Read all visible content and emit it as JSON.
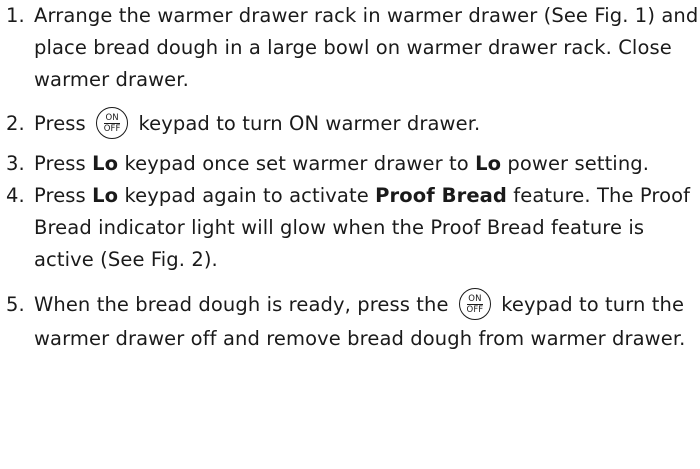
{
  "steps": [
    {
      "num": "1.",
      "text": "Arrange the warmer drawer rack in warmer drawer (See Fig. 1) and place bread dough in a large bowl on warmer drawer rack. Close warmer drawer."
    },
    {
      "num": "2.",
      "pre": "Press",
      "post": "keypad to turn ON warmer drawer."
    },
    {
      "num": "3.",
      "p1": "Press ",
      "b1": "Lo",
      "p2": " keypad once set warmer drawer to ",
      "b2": "Lo",
      "p3": " power setting."
    },
    {
      "num": "4.",
      "p1": "Press ",
      "b1": "Lo",
      "p2": " keypad again to activate ",
      "b2": "Proof Bread",
      "p3": " feature. The Proof Bread indicator light will glow when the Proof Bread feature is active (See Fig. 2)."
    },
    {
      "num": "5.",
      "pre": "When the bread dough is ready, press the",
      "post": "keypad to turn the warmer drawer off and remove bread dough from warmer drawer."
    }
  ],
  "keypad": {
    "on": "ON",
    "off": "OFF",
    "icon": "on-off-keypad-icon"
  }
}
